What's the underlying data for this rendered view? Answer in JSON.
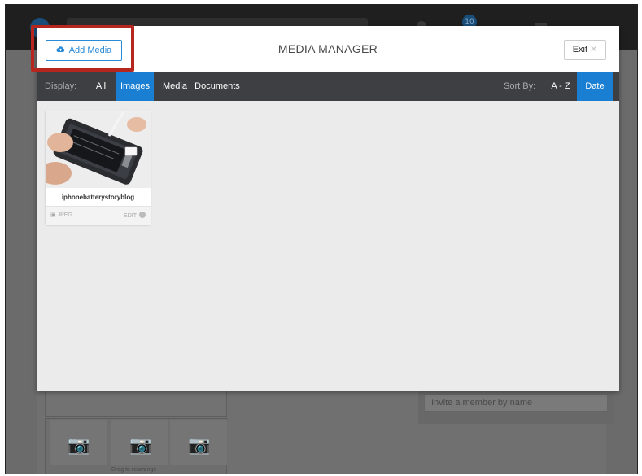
{
  "background": {
    "notification_count": "10",
    "invite_placeholder": "Invite a member by name",
    "drag_text": "Drag to rearrange"
  },
  "modal": {
    "title": "MEDIA MANAGER",
    "add_media_label": "Add Media",
    "add_media_icon": "cloud-upload-icon",
    "exit_label": "Exit",
    "exit_icon": "close-icon"
  },
  "toolbar": {
    "display_label": "Display:",
    "display_options": [
      "All",
      "Images",
      "Media",
      "Documents"
    ],
    "display_selected": "Images",
    "sort_label": "Sort By:",
    "sort_options": [
      "A - Z",
      "Date"
    ],
    "sort_selected": "Date"
  },
  "media_items": [
    {
      "name": "iphonebatterystoryblog",
      "type": "JPEG",
      "edit_label": "EDIT"
    }
  ],
  "colors": {
    "accent": "#1a7fd3",
    "highlight": "#b5261e",
    "toolbar": "#3d3f42"
  }
}
